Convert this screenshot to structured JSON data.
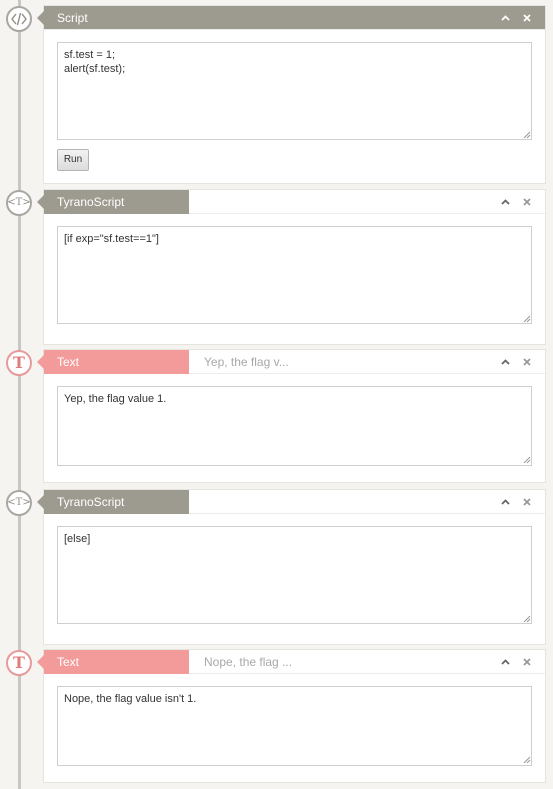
{
  "blocks": [
    {
      "type": "script",
      "icon": "code-icon",
      "title": "Script",
      "preview": "",
      "content": "sf.test = 1;\nalert(sf.test);",
      "button_label": "Run"
    },
    {
      "type": "tyranoscript",
      "icon": "tyranoscript-icon",
      "title": "TyranoScript",
      "preview": "",
      "content": "[if exp=\"sf.test==1\"]"
    },
    {
      "type": "text",
      "icon": "text-t-icon",
      "title": "Text",
      "preview": "Yep, the flag v...",
      "content": "Yep, the flag value 1."
    },
    {
      "type": "tyranoscript",
      "icon": "tyranoscript-icon",
      "title": "TyranoScript",
      "preview": "",
      "content": "[else]"
    },
    {
      "type": "text",
      "icon": "text-t-icon",
      "title": "Text",
      "preview": "Nope, the flag ...",
      "content": "Nope, the flag value isn't 1."
    }
  ],
  "node_glyphs": {
    "tyranoscript": "<T>",
    "text": "T"
  },
  "colors": {
    "gray_header": "#9d9a8f",
    "text_header": "#f39a9a",
    "timeline": "#c9c7c2"
  }
}
